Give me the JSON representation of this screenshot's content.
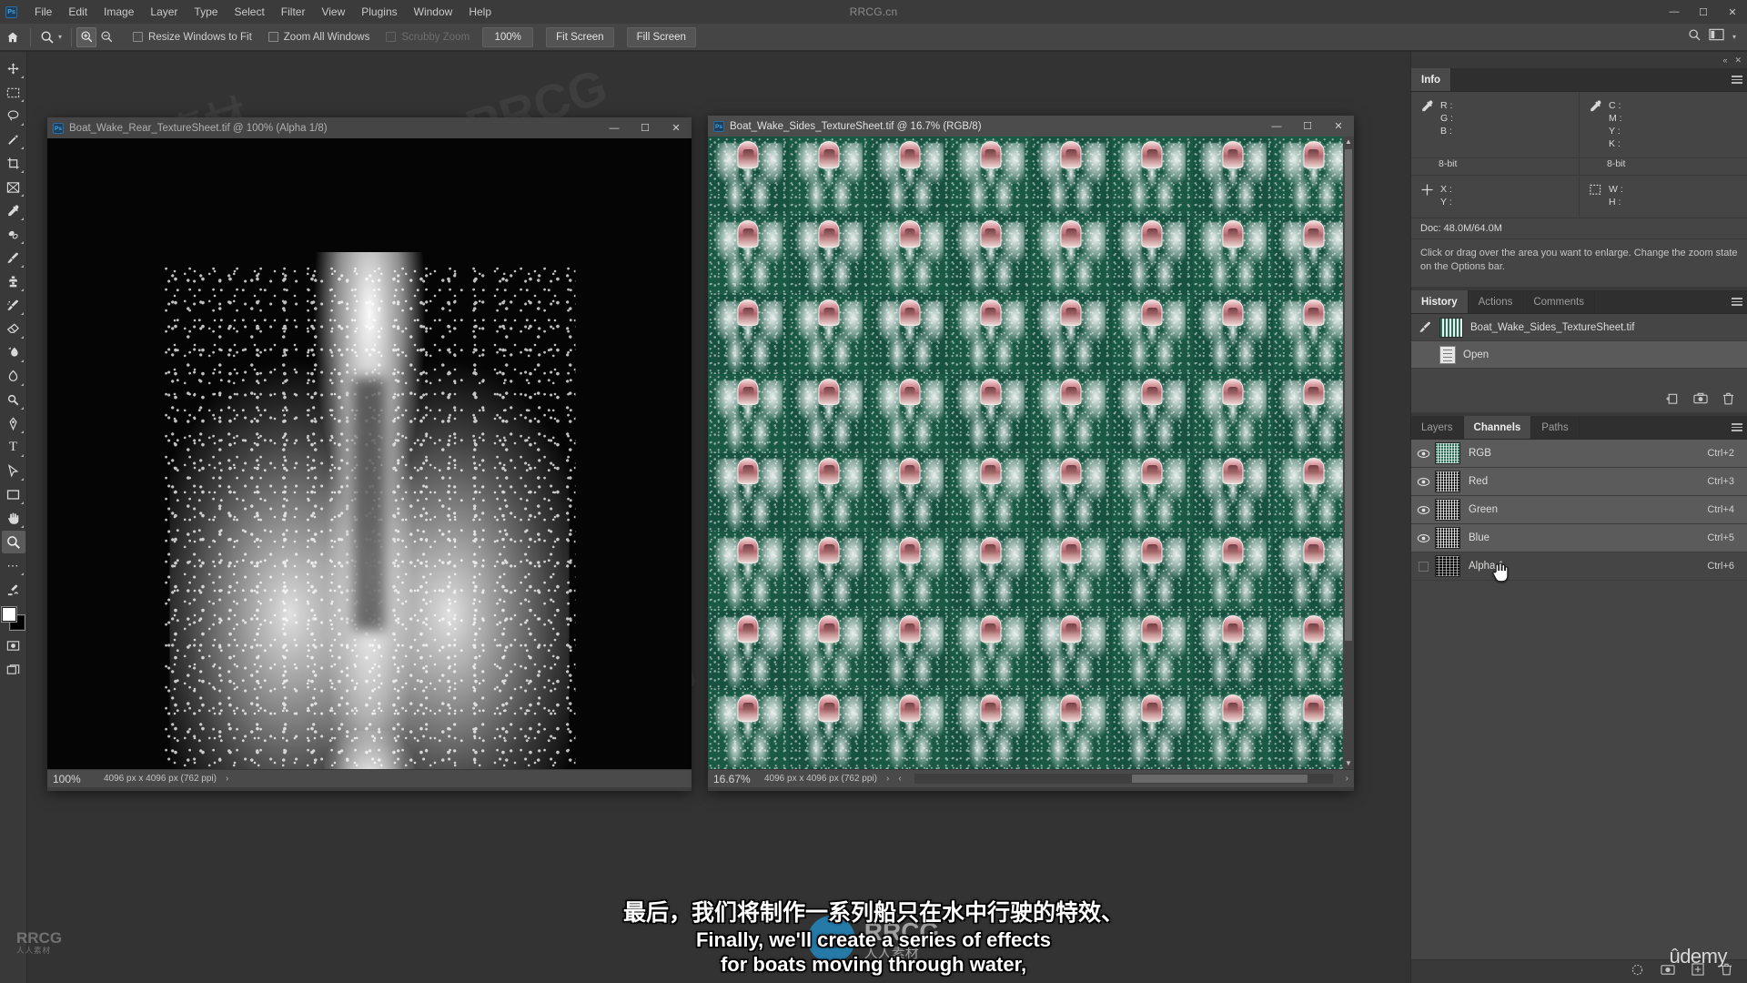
{
  "app": {
    "window_title": "RRCG.cn",
    "logo_text": "Ps"
  },
  "menubar": {
    "items": [
      "File",
      "Edit",
      "Image",
      "Layer",
      "Type",
      "Select",
      "Filter",
      "View",
      "Plugins",
      "Window",
      "Help"
    ]
  },
  "window_controls": {
    "minimize": "—",
    "maximize": "☐",
    "close": "✕"
  },
  "options_bar": {
    "home_icon": "home-icon",
    "tool_icon": "zoom-tool-icon",
    "zoom_in_icon": "zoom-in-icon",
    "zoom_out_icon": "zoom-out-icon",
    "checkboxes": [
      {
        "label": "Resize Windows to Fit",
        "checked": false,
        "disabled": false
      },
      {
        "label": "Zoom All Windows",
        "checked": false,
        "disabled": false
      },
      {
        "label": "Scrubby Zoom",
        "checked": false,
        "disabled": true
      }
    ],
    "buttons": [
      "100%",
      "Fit Screen",
      "Fill Screen"
    ],
    "right_icons": [
      "search-icon",
      "workspace-icon",
      "chevron-down-icon"
    ]
  },
  "toolbar": {
    "tools": [
      {
        "name": "move-tool",
        "glyph": "✥"
      },
      {
        "name": "marquee-tool",
        "glyph": "⬚"
      },
      {
        "name": "lasso-tool",
        "glyph": "◯"
      },
      {
        "name": "magic-wand-tool",
        "glyph": "✦"
      },
      {
        "name": "crop-tool",
        "glyph": "⌗"
      },
      {
        "name": "frame-tool",
        "glyph": "⛶"
      },
      {
        "name": "eyedropper-tool",
        "glyph": "✒"
      },
      {
        "name": "spot-healing-tool",
        "glyph": "✙"
      },
      {
        "name": "brush-tool",
        "glyph": "✎"
      },
      {
        "name": "clone-stamp-tool",
        "glyph": "⚑"
      },
      {
        "name": "history-brush-tool",
        "glyph": "✐"
      },
      {
        "name": "eraser-tool",
        "glyph": "▱"
      },
      {
        "name": "gradient-tool",
        "glyph": "◧"
      },
      {
        "name": "blur-tool",
        "glyph": "◖"
      },
      {
        "name": "dodge-tool",
        "glyph": "⚲"
      },
      {
        "name": "pen-tool",
        "glyph": "✒"
      },
      {
        "name": "type-tool",
        "glyph": "T"
      },
      {
        "name": "path-selection-tool",
        "glyph": "➤"
      },
      {
        "name": "rectangle-tool",
        "glyph": "▭"
      },
      {
        "name": "hand-tool",
        "glyph": "✋"
      },
      {
        "name": "zoom-tool",
        "glyph": "⚲",
        "selected": true
      },
      {
        "name": "more-tools",
        "glyph": "⋯"
      }
    ],
    "edit_toolbar_icon": "edit-toolbar-icon",
    "default_colors_icon": "default-colors-icon",
    "swap_colors_icon": "swap-colors-icon",
    "foreground_color": "#ffffff",
    "background_color": "#000000",
    "quick_mask_icon": "quick-mask-icon",
    "screen_mode_icon": "screen-mode-icon"
  },
  "documents": [
    {
      "title": "Boat_Wake_Rear_TextureSheet.tif @ 100% (Alpha 1/8)",
      "active": false,
      "status": {
        "zoom": "100%",
        "dimensions": "4096 px x 4096 px (762 ppi)",
        "arrow": "›"
      }
    },
    {
      "title": "Boat_Wake_Sides_TextureSheet.tif @ 16.7% (RGB/8)",
      "active": true,
      "status": {
        "zoom": "16.67%",
        "dimensions": "4096 px x 4096 px (762 ppi)",
        "arrow": "›",
        "left_arrow": "‹",
        "right_arrow": "›"
      }
    }
  ],
  "panels": {
    "info": {
      "tabs": [
        {
          "label": "Info",
          "active": true
        }
      ],
      "menu_icon": "panel-menu-icon",
      "quadrants": [
        {
          "icon": "eyedropper-icon",
          "rows": [
            "R :",
            "G :",
            "B :"
          ],
          "bit": "8-bit"
        },
        {
          "icon": "eyedropper-icon",
          "rows": [
            "C :",
            "M :",
            "Y :",
            "K :"
          ],
          "bit": "8-bit"
        },
        {
          "icon": "crosshair-icon",
          "rows": [
            "X :",
            "Y :"
          ],
          "bit": ""
        },
        {
          "icon": "selection-size-icon",
          "rows": [
            "W :",
            "H :"
          ],
          "bit": ""
        }
      ],
      "doc_size": "Doc: 48.0M/64.0M",
      "hint": "Click or drag over the area you want to enlarge. Change the zoom state on the Options bar."
    },
    "history": {
      "tabs": [
        {
          "label": "History",
          "active": true
        },
        {
          "label": "Actions",
          "active": false
        },
        {
          "label": "Comments",
          "active": false
        }
      ],
      "menu_icon": "panel-menu-icon",
      "items": [
        {
          "label": "Boat_Wake_Sides_TextureSheet.tif",
          "type": "snapshot",
          "selected": false
        },
        {
          "label": "Open",
          "type": "state",
          "selected": true
        }
      ],
      "footer_icons": [
        "create-document-from-state-icon",
        "create-snapshot-icon",
        "delete-state-icon"
      ]
    },
    "channels": {
      "tabs": [
        {
          "label": "Layers",
          "active": false
        },
        {
          "label": "Channels",
          "active": true
        },
        {
          "label": "Paths",
          "active": false
        }
      ],
      "menu_icon": "panel-menu-icon",
      "rows": [
        {
          "label": "RGB",
          "shortcut": "Ctrl+2",
          "visible": true,
          "selected": true,
          "thumb": "rgb"
        },
        {
          "label": "Red",
          "shortcut": "Ctrl+3",
          "visible": true,
          "selected": true,
          "thumb": "mono"
        },
        {
          "label": "Green",
          "shortcut": "Ctrl+4",
          "visible": true,
          "selected": true,
          "thumb": "mono"
        },
        {
          "label": "Blue",
          "shortcut": "Ctrl+5",
          "visible": true,
          "selected": true,
          "thumb": "mono"
        },
        {
          "label": "Alpha 1",
          "shortcut": "Ctrl+6",
          "visible": false,
          "selected": false,
          "thumb": "alpha"
        }
      ],
      "footer_icons": [
        "load-channel-as-selection-icon",
        "save-selection-as-channel-icon",
        "create-new-channel-icon",
        "delete-channel-icon"
      ]
    }
  },
  "dock_header": {
    "collapse_icon": "«",
    "close_icon": "✕"
  },
  "subtitles": {
    "chinese": "最后，我们将制作一系列船只在水中行驶的特效、",
    "english_line1": "Finally, we'll create a series of effects",
    "english_line2": "for boats moving through water,"
  },
  "branding": {
    "bottom_left": "RRCG",
    "bottom_left_sub": "人人素材",
    "udemy": "ûdemy",
    "center_logo": "RRCG",
    "center_logo_sub": "人人素材"
  },
  "watermarks": [
    "人人素材",
    "RRCG",
    "素材"
  ],
  "colors": {
    "chrome": "#393939",
    "options_bar": "#454545",
    "panel_bg": "#454545",
    "canvas_bg": "#333333",
    "accent_blue": "#2196d6",
    "sheet_green": "#16523f"
  }
}
